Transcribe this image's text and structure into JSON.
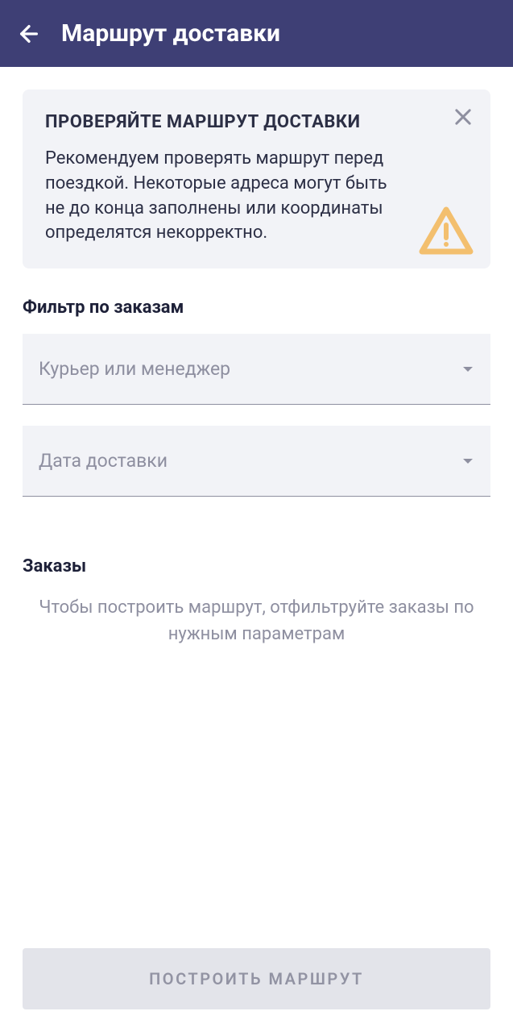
{
  "header": {
    "title": "Маршрут доставки"
  },
  "info_card": {
    "title": "ПРОВЕРЯЙТЕ МАРШРУТ ДОСТАВКИ",
    "text": "Рекомендуем проверять маршрут перед поездкой. Некоторые адреса могут быть не до конца заполнены или координаты определятся некорректно."
  },
  "filter": {
    "label": "Фильтр по заказам",
    "courier_placeholder": "Курьер или менеджер",
    "date_placeholder": "Дата доставки"
  },
  "orders": {
    "label": "Заказы",
    "empty_text": "Чтобы построить маршрут, отфильтруйте заказы по нужным параметрам"
  },
  "button": {
    "build_label": "ПОСТРОИТЬ МАРШРУТ"
  }
}
